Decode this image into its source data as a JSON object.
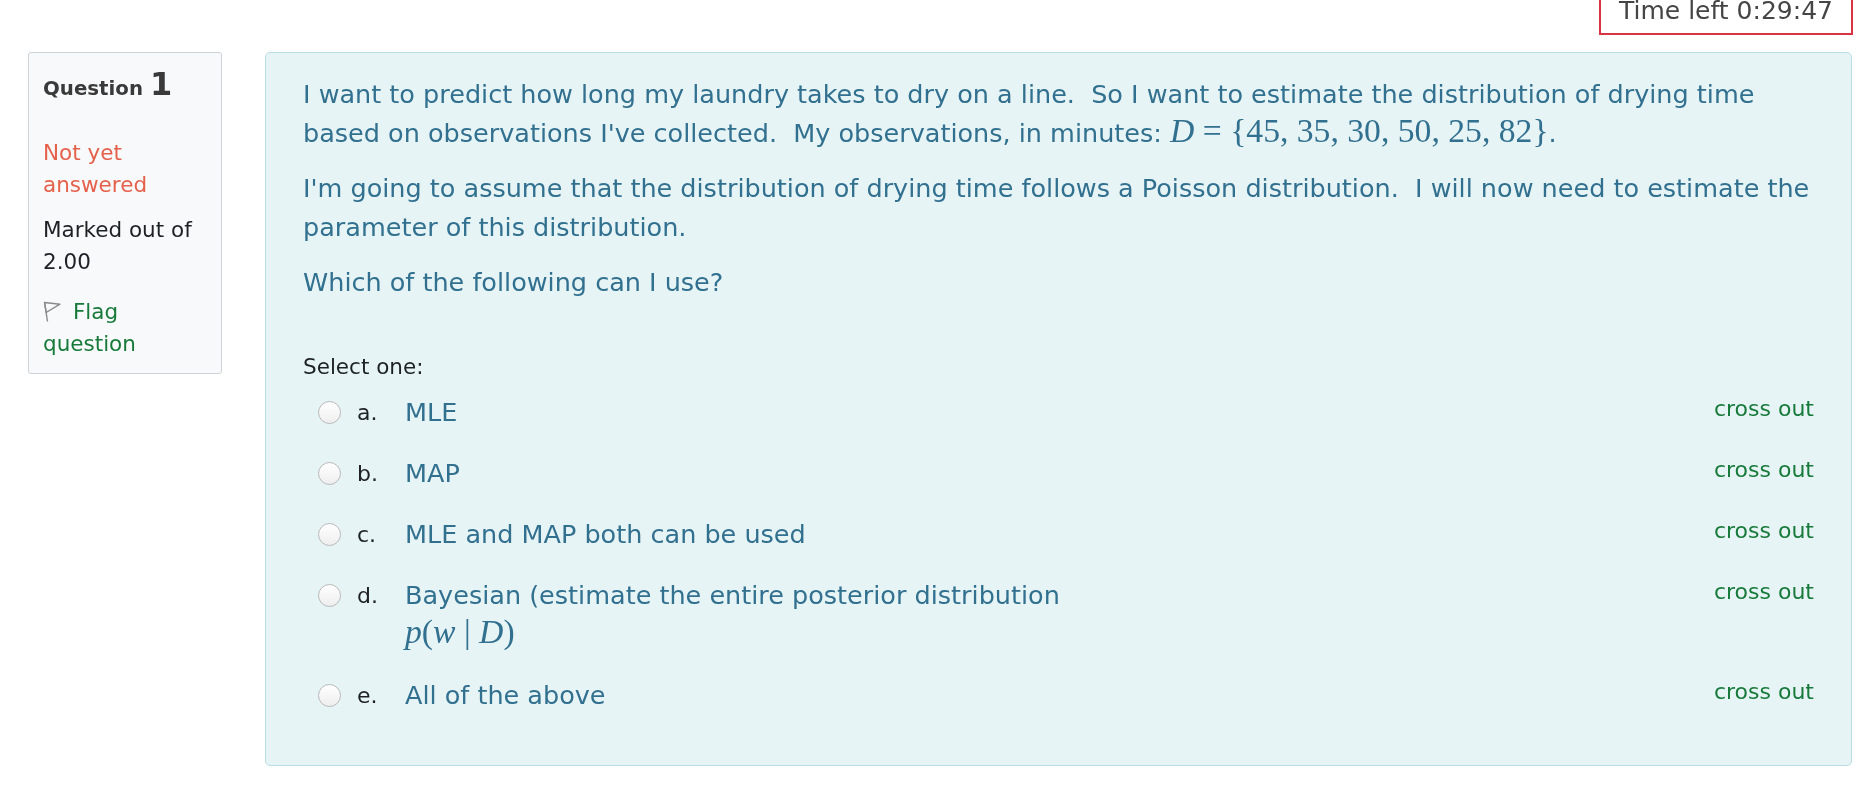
{
  "timer": {
    "text": "Time left 0:29:47"
  },
  "info": {
    "label": "Question",
    "number": "1",
    "state": "Not yet answered",
    "marks": "Marked out of 2.00",
    "flag": {
      "text": "Flag question",
      "flagged": false
    }
  },
  "question": {
    "paragraphs": [
      {
        "parts": [
          {
            "kind": "text",
            "text": "I want to predict how long my laundry takes to dry on a line.  So I want to estimate the distribution of drying time based on observations I've collected.  My observations, in minutes: "
          },
          {
            "kind": "math",
            "text": "*D* = {45, 35, 30, 50, 25, 82}"
          },
          {
            "kind": "text",
            "text": "."
          }
        ]
      },
      {
        "parts": [
          {
            "kind": "text",
            "text": "I'm going to assume that the distribution of drying time follows a Poisson distribution.  I will now need to estimate the parameter of this distribution."
          }
        ]
      },
      {
        "parts": [
          {
            "kind": "text",
            "text": "Which of the following can I use?"
          }
        ]
      }
    ],
    "prompt": "Select one:",
    "options": [
      {
        "letter": "a.",
        "parts": [
          {
            "kind": "text",
            "text": "MLE"
          }
        ],
        "selected": false,
        "cross_out": "cross out"
      },
      {
        "letter": "b.",
        "parts": [
          {
            "kind": "text",
            "text": "MAP"
          }
        ],
        "selected": false,
        "cross_out": "cross out"
      },
      {
        "letter": "c.",
        "parts": [
          {
            "kind": "text",
            "text": "MLE and MAP both can be used"
          }
        ],
        "selected": false,
        "cross_out": "cross out"
      },
      {
        "letter": "d.",
        "parts": [
          {
            "kind": "text",
            "text": "Bayesian (estimate the entire posterior distribution "
          },
          {
            "kind": "math",
            "text": "*p*(*w* | *D*)"
          }
        ],
        "selected": false,
        "cross_out": "cross out"
      },
      {
        "letter": "e.",
        "parts": [
          {
            "kind": "text",
            "text": "All of the above"
          }
        ],
        "selected": false,
        "cross_out": "cross out"
      }
    ]
  }
}
